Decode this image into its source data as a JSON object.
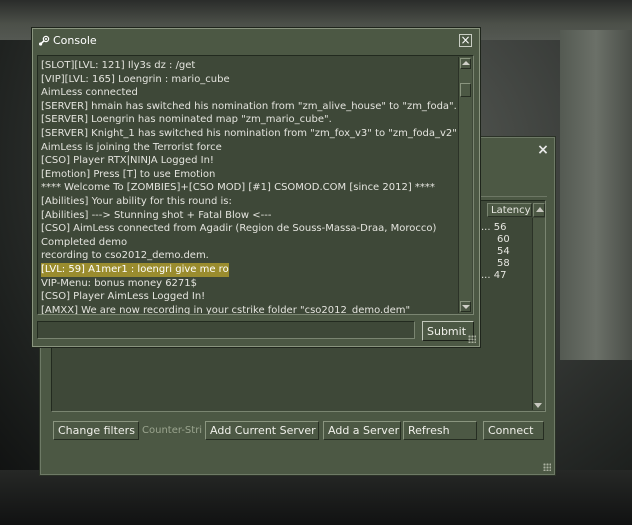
{
  "console": {
    "title": "Console",
    "title_icon": "steam-icon",
    "lines": [
      "[SLOT][LVL: 121] Ily3s dz : /get",
      "[VIP][LVL: 165] Loengrin : mario_cube",
      "AimLess connected",
      "[SERVER] hmain has switched his nomination from \"zm_alive_house\" to \"zm_foda\".",
      "[SERVER] Loengrin has nominated map \"zm_mario_cube\".",
      "[SERVER] Knight_1 has switched his nomination from \"zm_fox_v3\" to \"zm_foda_v2\".",
      "AimLess is joining the Terrorist force",
      "[CSO] Player RTX|NINJA Logged In!",
      "[Emotion] Press [T] to use Emotion",
      "**** Welcome To [ZOMBIES]+[CSO MOD] [#1] CSOMOD.COM [since 2012] ****",
      "[Abilities] Your ability for this round is:",
      "[Abilities] ---> Stunning shot + Fatal Blow <---",
      "[CSO] AimLess connected from Agadir (Region de Souss-Massa-Draa, Morocco)",
      "Completed demo",
      "recording to cso2012_demo.dem.",
      "[LVL: 59] A1mer1 : loengri give me rod",
      "VIP-Menu: bonus money 6271$",
      "[CSO] Player AimLess Logged In!",
      "[AMXX] We are now recording in your cstrike folder \"cso2012_demo.dem\""
    ],
    "highlighted_line_index": 15,
    "command_value": "",
    "submit_label": "Submit",
    "close_glyph": "×"
  },
  "browser": {
    "close_glyph": "×",
    "latency_header": "Latency",
    "latencies": [
      "56",
      "60",
      "54",
      "58",
      "47"
    ],
    "truncation_marker": "...",
    "buttons": {
      "change_filters": "Change filters",
      "game_filter": "Counter-Strike",
      "add_current_server": "Add Current Server",
      "add_server": "Add a Server",
      "refresh": "Refresh",
      "connect": "Connect"
    }
  },
  "colors": {
    "panel": "#4c5844",
    "panel_inset": "#3e4838",
    "highlight": "#9a8c2e"
  }
}
